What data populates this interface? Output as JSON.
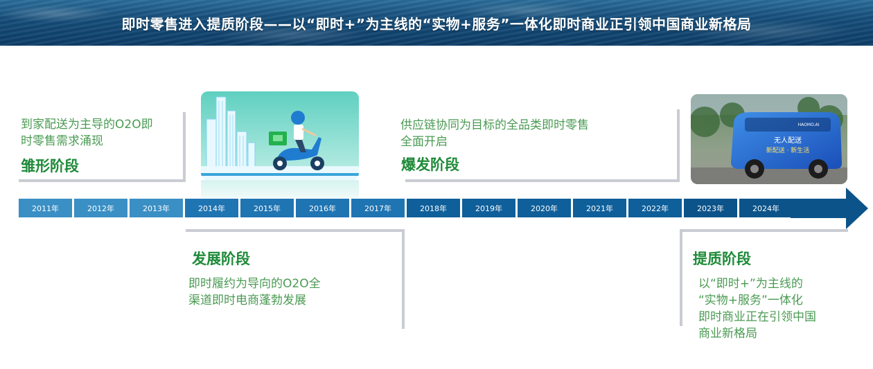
{
  "header": {
    "title": "即时零售进入提质阶段——以“即时+”为主线的“实物+服务”一体化即时商业正引领中国商业新格局"
  },
  "stages": [
    {
      "id": "embryo",
      "title": "雏形阶段",
      "desc": [
        "到家配送为主导的O2O即",
        "时零售需求涌现"
      ]
    },
    {
      "id": "develop",
      "title": "发展阶段",
      "desc": [
        "即时履约为导向的O2O全",
        "渠道即时电商蓬勃发展"
      ]
    },
    {
      "id": "explode",
      "title": "爆发阶段",
      "desc": [
        "供应链协同为目标的全品类即时零售",
        "全面开启"
      ]
    },
    {
      "id": "quality",
      "title": "提质阶段",
      "desc": [
        "以“即时+”为主线的",
        "“实物+服务”一体化",
        "即时商业正在引领中国",
        "商业新格局"
      ]
    }
  ],
  "timeline": {
    "years": [
      "2011年",
      "2012年",
      "2013年",
      "2014年",
      "2015年",
      "2016年",
      "2017年",
      "2018年",
      "2019年",
      "2020年",
      "2021年",
      "2022年",
      "2023年",
      "2024年"
    ],
    "colors": [
      "#3a8fc4",
      "#3a8fc4",
      "#3a8fc4",
      "#1f74b2",
      "#1f74b2",
      "#1f74b2",
      "#1f74b2",
      "#0f5f9a",
      "#0f5f9a",
      "#0f5f9a",
      "#0f5f9a",
      "#0f5f9a",
      "#0b5389",
      "#0b5389"
    ],
    "arrow_color": "#0b5389"
  },
  "images": {
    "delivery": {
      "icon": "scooter-courier-illustration"
    },
    "vehicle": {
      "icon": "autonomous-delivery-vehicle-photo",
      "banner_line1": "无人配送",
      "banner_line2": "新配送 · 新生活",
      "brand": "HAOMO.AI"
    }
  }
}
